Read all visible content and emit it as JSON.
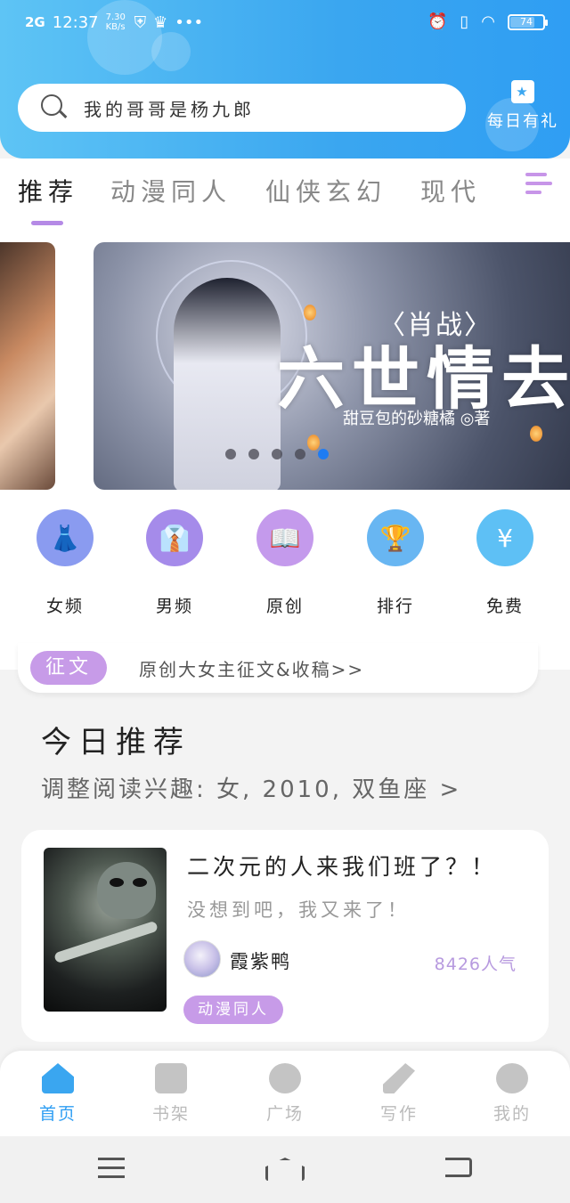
{
  "status_bar": {
    "signal": "2G",
    "time": "12:37",
    "speed": "7.30 KB/s",
    "more": "•••",
    "battery": "74",
    "battery_level": 0.74
  },
  "search": {
    "placeholder": "我的哥哥是杨九郎"
  },
  "daily_gift": {
    "label": "每日有礼"
  },
  "tabs": [
    {
      "label": "推荐",
      "active": true
    },
    {
      "label": "动漫同人",
      "active": false
    },
    {
      "label": "仙侠玄幻",
      "active": false
    },
    {
      "label": "现代",
      "active": false
    }
  ],
  "banner": {
    "tag": "〈肖战〉",
    "title": "六世情去",
    "author": "甜豆包的砂糖橘 ◎著",
    "dots_count": 5,
    "active_dot": 4
  },
  "categories": [
    {
      "label": "女频",
      "icon": "dress-icon",
      "color": "#8a9bf0"
    },
    {
      "label": "男频",
      "icon": "suit-icon",
      "color": "#a58bea"
    },
    {
      "label": "原创",
      "icon": "book-icon",
      "color": "#c49aec"
    },
    {
      "label": "排行",
      "icon": "trophy-icon",
      "color": "#68b6f2"
    },
    {
      "label": "免费",
      "icon": "coin-icon",
      "color": "#5ec0f5"
    }
  ],
  "notice": {
    "badge": "征文",
    "text": "原创大女主征文&收稿>>"
  },
  "today": {
    "title": "今日推荐",
    "subtitle": "调整阅读兴趣: 女, 2010, 双鱼座 >"
  },
  "book": {
    "title": "二次元的人来我们班了？！",
    "description": "没想到吧，我又来了！",
    "author": "霞紫鸭",
    "popularity": "8426人气",
    "tag": "动漫同人"
  },
  "bottom_nav": [
    {
      "label": "首页",
      "icon": "home-icon",
      "active": true
    },
    {
      "label": "书架",
      "icon": "bookshelf-icon",
      "active": false
    },
    {
      "label": "广场",
      "icon": "planet-icon",
      "active": false
    },
    {
      "label": "写作",
      "icon": "pen-icon",
      "active": false
    },
    {
      "label": "我的",
      "icon": "chat-icon",
      "active": false
    }
  ]
}
